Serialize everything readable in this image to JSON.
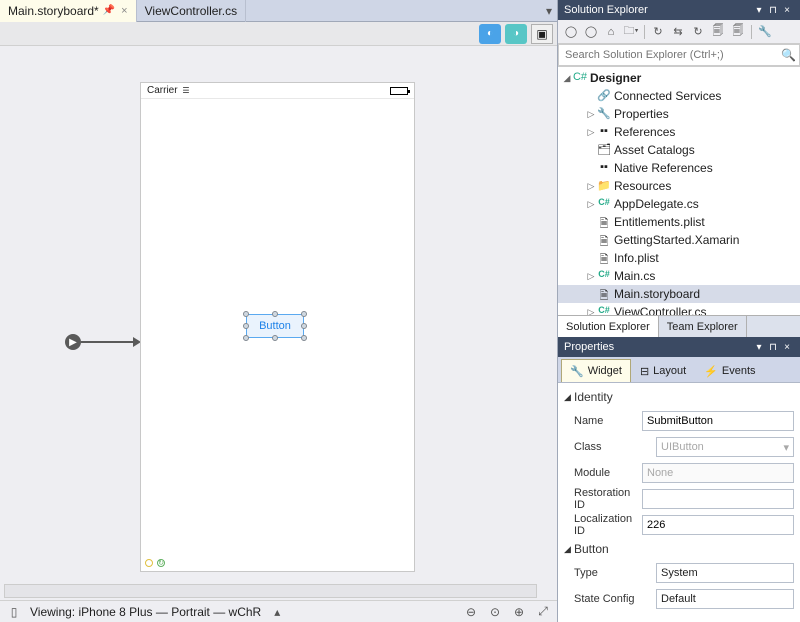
{
  "tabs": [
    {
      "label": "Main.storyboard*",
      "active": true,
      "pinned": true
    },
    {
      "label": "ViewController.cs",
      "active": false
    }
  ],
  "designer": {
    "carrier_label": "Carrier",
    "button_text": "Button",
    "entry_arrow_glyph": "▶"
  },
  "statusbar": {
    "viewing": "Viewing: iPhone 8 Plus — Portrait — wChR"
  },
  "solution_explorer": {
    "title": "Solution Explorer",
    "search_placeholder": "Search Solution Explorer (Ctrl+;)",
    "root": "Designer",
    "items": [
      {
        "label": "Connected Services",
        "icon": "link",
        "indent": 2,
        "expand": ""
      },
      {
        "label": "Properties",
        "icon": "wrench",
        "indent": 2,
        "expand": "▷"
      },
      {
        "label": "References",
        "icon": "refs",
        "indent": 2,
        "expand": "▷"
      },
      {
        "label": "Asset Catalogs",
        "icon": "assets",
        "indent": 2,
        "expand": ""
      },
      {
        "label": "Native References",
        "icon": "refs",
        "indent": 2,
        "expand": ""
      },
      {
        "label": "Resources",
        "icon": "folder",
        "indent": 2,
        "expand": "▷"
      },
      {
        "label": "AppDelegate.cs",
        "icon": "cs",
        "indent": 2,
        "expand": "▷"
      },
      {
        "label": "Entitlements.plist",
        "icon": "file",
        "indent": 2,
        "expand": ""
      },
      {
        "label": "GettingStarted.Xamarin",
        "icon": "file",
        "indent": 2,
        "expand": ""
      },
      {
        "label": "Info.plist",
        "icon": "file",
        "indent": 2,
        "expand": ""
      },
      {
        "label": "Main.cs",
        "icon": "cs",
        "indent": 2,
        "expand": "▷"
      },
      {
        "label": "Main.storyboard",
        "icon": "file",
        "indent": 2,
        "expand": "",
        "sel": true
      },
      {
        "label": "ViewController.cs",
        "icon": "cs",
        "indent": 2,
        "expand": "▷"
      }
    ],
    "bottom_tabs": [
      "Solution Explorer",
      "Team Explorer"
    ]
  },
  "properties": {
    "title": "Properties",
    "tabs": [
      "Widget",
      "Layout",
      "Events"
    ],
    "sections": {
      "identity": "Identity",
      "button": "Button"
    },
    "fields": {
      "name_label": "Name",
      "name_value": "SubmitButton",
      "class_label": "Class",
      "class_value": "UIButton",
      "module_label": "Module",
      "module_value": "None",
      "restoration_label": "Restoration ID",
      "restoration_value": "",
      "localization_label": "Localization ID",
      "localization_value": "226",
      "type_label": "Type",
      "type_value": "System",
      "stateconfig_label": "State Config",
      "stateconfig_value": "Default"
    }
  }
}
